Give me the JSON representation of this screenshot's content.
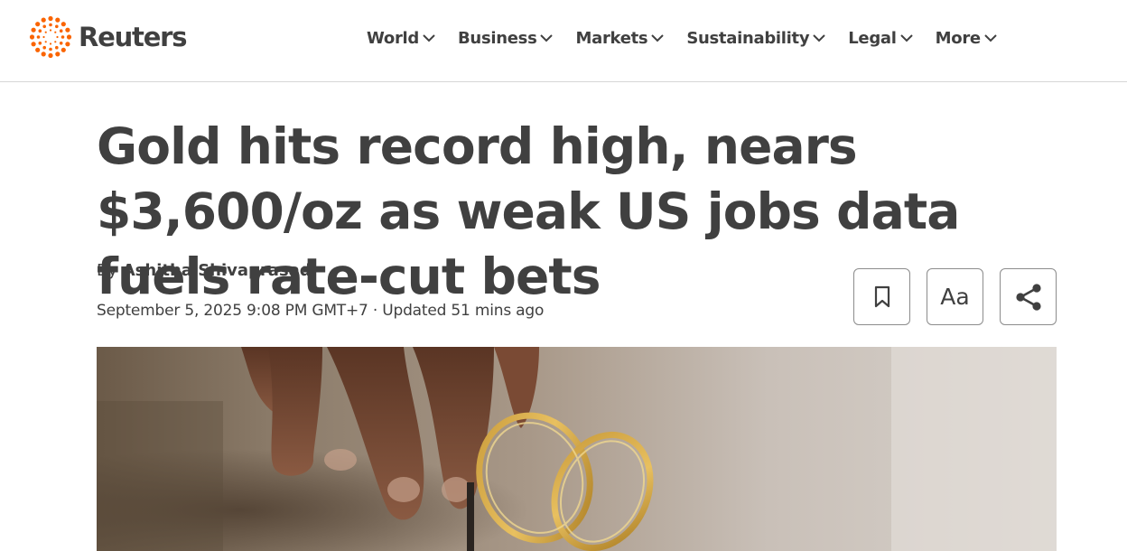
{
  "header": {
    "logo_text": "Reuters",
    "logo_color": "#fa6400",
    "nav": [
      {
        "label": "World",
        "icon": "chevron-down-icon"
      },
      {
        "label": "Business",
        "icon": "chevron-down-icon"
      },
      {
        "label": "Markets",
        "icon": "chevron-down-icon"
      },
      {
        "label": "Sustainability",
        "icon": "chevron-down-icon"
      },
      {
        "label": "Legal",
        "icon": "chevron-down-icon"
      },
      {
        "label": "More",
        "icon": "chevron-down-icon"
      }
    ]
  },
  "article": {
    "headline": "Gold hits record high, nears $3,600/oz as weak US jobs data fuels rate-cut bets",
    "byline_prefix": "By",
    "author": "Ashitha Shivaprasad",
    "dateline": "September 5, 2025 9:08 PM GMT+7 · Updated 51 mins ago",
    "tools": [
      {
        "name": "bookmark",
        "icon": "bookmark-icon"
      },
      {
        "name": "text-size",
        "label": "Aa"
      },
      {
        "name": "share",
        "icon": "share-icon"
      }
    ],
    "hero_image": "hand holding gold bangles"
  }
}
